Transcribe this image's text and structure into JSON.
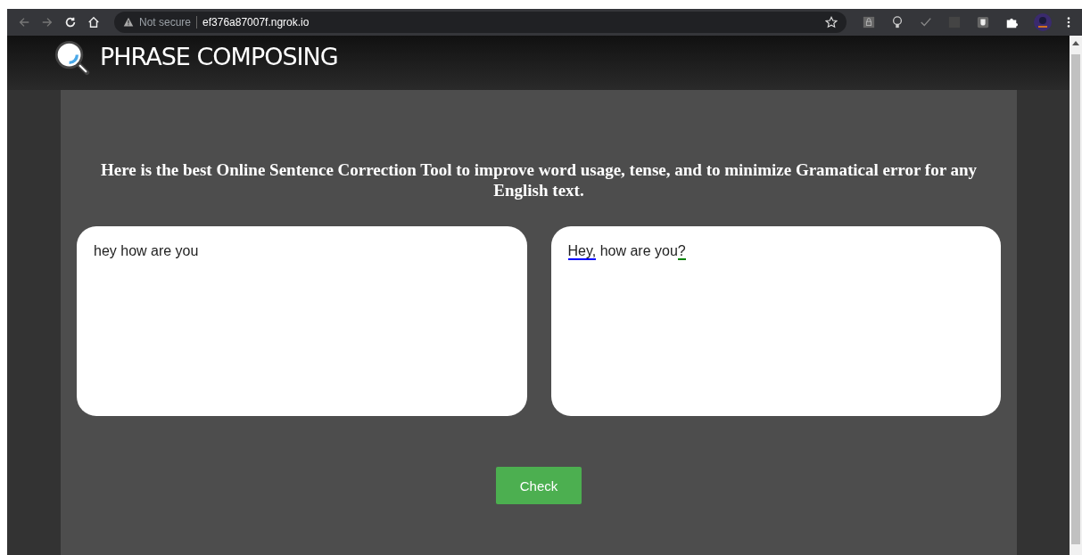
{
  "browser": {
    "security": "Not secure",
    "url": "ef376a87007f.ngrok.io"
  },
  "site": {
    "title": "PHRASE COMPOSING"
  },
  "intro": "Here is the best Online Sentence Correction Tool to improve word usage, tense, and to minimize Gramatical error for any English text.",
  "input": {
    "value": "hey how are you"
  },
  "output": {
    "segments": [
      {
        "text": "Hey,",
        "color": "#0000ff"
      },
      {
        "text": " how are you"
      },
      {
        "text": "?",
        "color": "#008000"
      }
    ]
  },
  "button": "Check"
}
